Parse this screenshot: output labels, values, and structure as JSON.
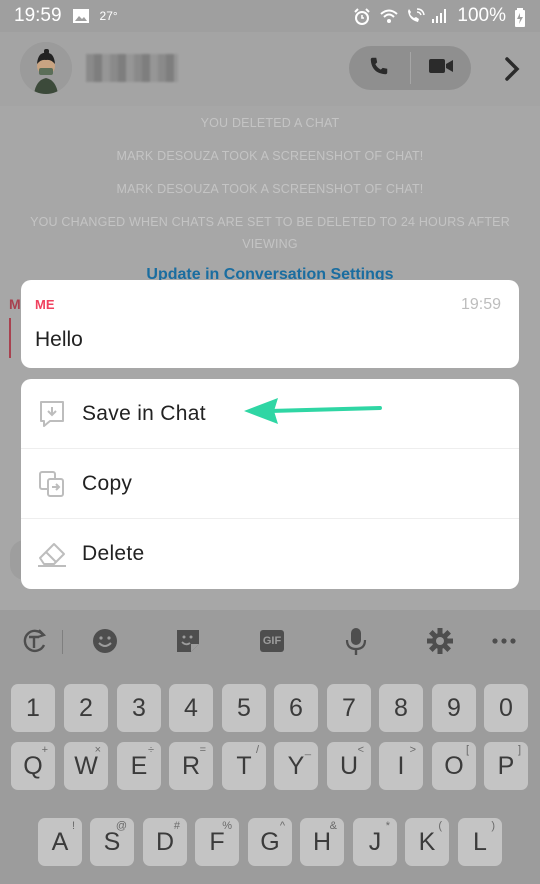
{
  "status_bar": {
    "time": "19:59",
    "temperature": "27°",
    "battery": "100%",
    "icons": [
      "image-icon",
      "alarm-icon",
      "wifi-icon",
      "wifi-calling-icon",
      "signal-icon",
      "battery-icon"
    ]
  },
  "chat_header": {
    "contact_name": "",
    "icons": [
      "avatar",
      "phone-icon",
      "video-icon",
      "chevron-right-icon"
    ]
  },
  "system_messages": [
    "YOU DELETED A CHAT",
    "MARK DESOUZA TOOK A SCREENSHOT OF CHAT!",
    "MARK DESOUZA TOOK A SCREENSHOT OF CHAT!",
    "YOU CHANGED WHEN CHATS ARE SET TO BE DELETED TO 24 HOURS AFTER",
    "VIEWING"
  ],
  "settings_link": "Update in Conversation Settings",
  "message": {
    "sender": "ME",
    "time": "19:59",
    "text": "Hello",
    "side_label": "M"
  },
  "menu": {
    "items": [
      {
        "label": "Save in Chat",
        "icon": "save-in-chat-icon"
      },
      {
        "label": "Copy",
        "icon": "copy-icon"
      },
      {
        "label": "Delete",
        "icon": "eraser-icon"
      }
    ]
  },
  "annotation": {
    "color": "#2fd6a4",
    "icon": "arrow-left-icon"
  },
  "keyboard": {
    "toolbar": [
      "translate-icon",
      "emoji-icon",
      "sticker-icon",
      "GIF",
      "microphone-icon",
      "gear-icon",
      "more-icon"
    ],
    "gif_label": "GIF",
    "row_numbers": [
      "1",
      "2",
      "3",
      "4",
      "5",
      "6",
      "7",
      "8",
      "9",
      "0"
    ],
    "row_q": [
      "Q",
      "W",
      "E",
      "R",
      "T",
      "Y",
      "U",
      "I",
      "O",
      "P"
    ],
    "row_q_hints": [
      "+",
      "×",
      "÷",
      "=",
      "/",
      "_",
      "<",
      ">",
      "[",
      "]"
    ],
    "row_a": [
      "A",
      "S",
      "D",
      "F",
      "G",
      "H",
      "J",
      "K",
      "L"
    ],
    "row_a_hints": [
      "!",
      "@",
      "#",
      "%",
      "^",
      "&",
      "*",
      "(",
      ")"
    ]
  },
  "colors": {
    "accent_red": "#f0415e",
    "link_blue": "#1a6da0",
    "arrow_green": "#2fd6a4",
    "dim_overlay": "#a7a7a7"
  }
}
